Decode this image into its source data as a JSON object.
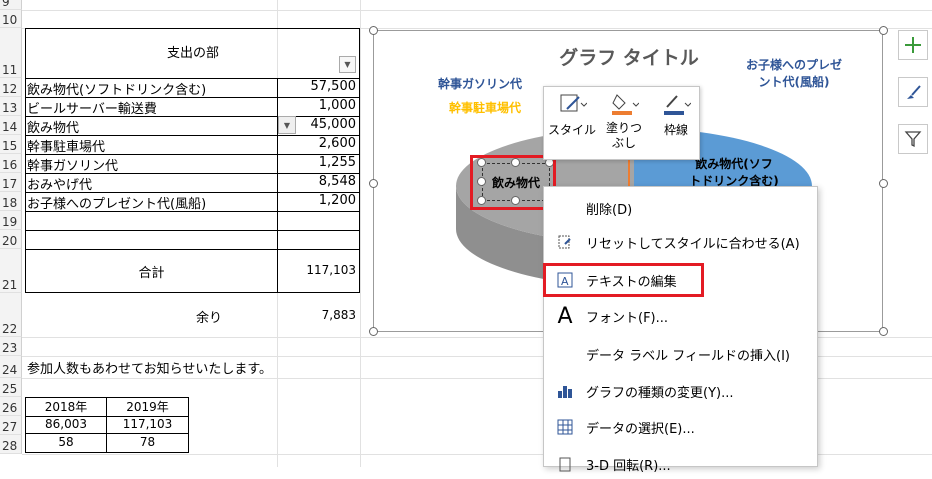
{
  "sheet": {
    "row_numbers": [
      "9",
      "10",
      "11",
      "12",
      "13",
      "14",
      "15",
      "16",
      "17",
      "18",
      "19",
      "20",
      "21",
      "22",
      "23",
      "24",
      "25",
      "26",
      "27",
      "28"
    ],
    "expense_header": "支出の部",
    "items": [
      {
        "name": "飲み物代(ソフトドリンク含む)",
        "amount": "57,500"
      },
      {
        "name": "ビールサーバー輸送費",
        "amount": "1,000"
      },
      {
        "name": "飲み物代",
        "amount": "45,000"
      },
      {
        "name": "幹事駐車場代",
        "amount": "2,600"
      },
      {
        "name": "幹事ガソリン代",
        "amount": "1,255"
      },
      {
        "name": "おみやげ代",
        "amount": "8,548"
      },
      {
        "name": "お子様へのプレゼント代(風船)",
        "amount": "1,200"
      }
    ],
    "total_label": "合計",
    "total_value": "117,103",
    "remain_label": "余り",
    "remain_value": "7,883",
    "notice": "参加人数もあわせてお知らせいたします。",
    "year_headers": [
      "2018年",
      "2019年"
    ],
    "year_row1": [
      "86,003",
      "117,103"
    ],
    "year_row2": [
      "58",
      "78"
    ]
  },
  "chart": {
    "title": "グラフ タイトル",
    "labels": {
      "gasoline": "幹事ガソリン代",
      "parking": "幹事駐車場代",
      "present": "お子様へのプレゼ\nント代(風船)",
      "soft": "飲み物代(ソフ\nトドリンク含む)",
      "selected": "飲み物代"
    },
    "colors": {
      "gray": "#a5a5a5",
      "blue": "#5b9bd5",
      "orange": "#ed7d31",
      "gold": "#ffc000",
      "label_blue": "#2f5597"
    }
  },
  "mini_toolbar": {
    "style": "スタイル",
    "fill": "塗りつ\nぶし",
    "outline": "枠線"
  },
  "context_menu": {
    "items": [
      {
        "label": "削除(D)",
        "icon": ""
      },
      {
        "label": "リセットしてスタイルに合わせる(A)",
        "icon": "reset-style-icon"
      },
      {
        "label": "テキストの編集",
        "icon": "edit-text-icon"
      },
      {
        "label": "フォント(F)...",
        "icon": "font-icon"
      },
      {
        "label": "データ ラベル フィールドの挿入(I)",
        "icon": ""
      },
      {
        "label": "グラフの種類の変更(Y)...",
        "icon": "chart-type-icon"
      },
      {
        "label": "データの選択(E)...",
        "icon": "select-data-icon"
      },
      {
        "label": "3-D 回転(R)...",
        "icon": "3d-rotation-icon"
      }
    ]
  },
  "side_buttons": [
    "chart-elements-icon",
    "chart-styles-icon",
    "chart-filter-icon"
  ],
  "highlight_color": "#e31b23"
}
